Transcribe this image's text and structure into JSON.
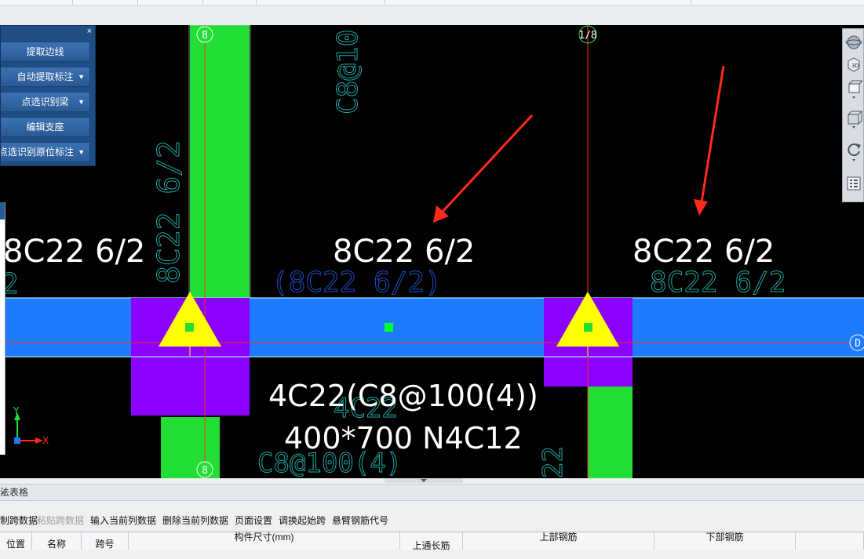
{
  "panel": {
    "close_label": "×",
    "buttons": [
      {
        "label": "提取边线",
        "dropdown": false
      },
      {
        "label": "自动提取标注",
        "dropdown": true
      },
      {
        "label": "点选识别梁",
        "dropdown": true
      },
      {
        "label": "编辑支座",
        "dropdown": false
      },
      {
        "label": "点选识别原位标注",
        "dropdown": true
      }
    ],
    "dropdown_glyph": "▼"
  },
  "cad": {
    "axis_labels": {
      "top_left": "8",
      "top_right": "1/8",
      "bottom_left": "8",
      "right_edge": "D"
    },
    "rebar_labels": {
      "left": "8C22 6/2",
      "center": "8C22 6/2",
      "right": "8C22 6/2"
    },
    "original_annotations": {
      "vertical_left": "8C22 6/2",
      "vertical_top": "C8@10",
      "center_faded": "(8C22 6/2)",
      "right_faded": "8C22 6/2",
      "bottom_faded": "4C22",
      "bottom_stirrup": "C8@100(4)",
      "bottom_right": "22",
      "left_edge": "2"
    },
    "beam_annotation": {
      "line1": "4C22(C8@100(4))",
      "line2": "400*700 N4C12"
    },
    "ucs": {
      "y": "Y",
      "x": "X"
    },
    "colors": {
      "beam": "#1e7bff",
      "column": "#22dd33",
      "support": "#8b00ff",
      "triangle": "#ffff00",
      "arrow": "#ff2a1a",
      "axis": "#ff2a1a",
      "cad_text": "#1fa9a3",
      "faded_blue": "#1f4fcf"
    }
  },
  "view_tools": [
    "globe-icon",
    "3d-view-icon",
    "box-view-icon",
    "cube-icon",
    "rotate-icon",
    "view-settings-icon"
  ],
  "table": {
    "title": "平法表格",
    "close_label": "×",
    "toolbar": [
      {
        "label": "复制跨数据",
        "disabled": false
      },
      {
        "label": "粘贴跨数据",
        "disabled": true
      },
      {
        "label": "输入当前列数据",
        "disabled": false
      },
      {
        "label": "删除当前列数据",
        "disabled": false
      },
      {
        "label": "页面设置",
        "disabled": false
      },
      {
        "label": "调换起始跨",
        "disabled": false
      },
      {
        "label": "悬臂钢筋代号",
        "disabled": false
      }
    ],
    "headers": {
      "position": "位置",
      "name": "名称",
      "span": "跨号",
      "dims": "构件尺寸(mm)",
      "top_through": "上通长筋",
      "top_rebar": "上部钢筋",
      "bottom_rebar": "下部钢筋"
    }
  }
}
